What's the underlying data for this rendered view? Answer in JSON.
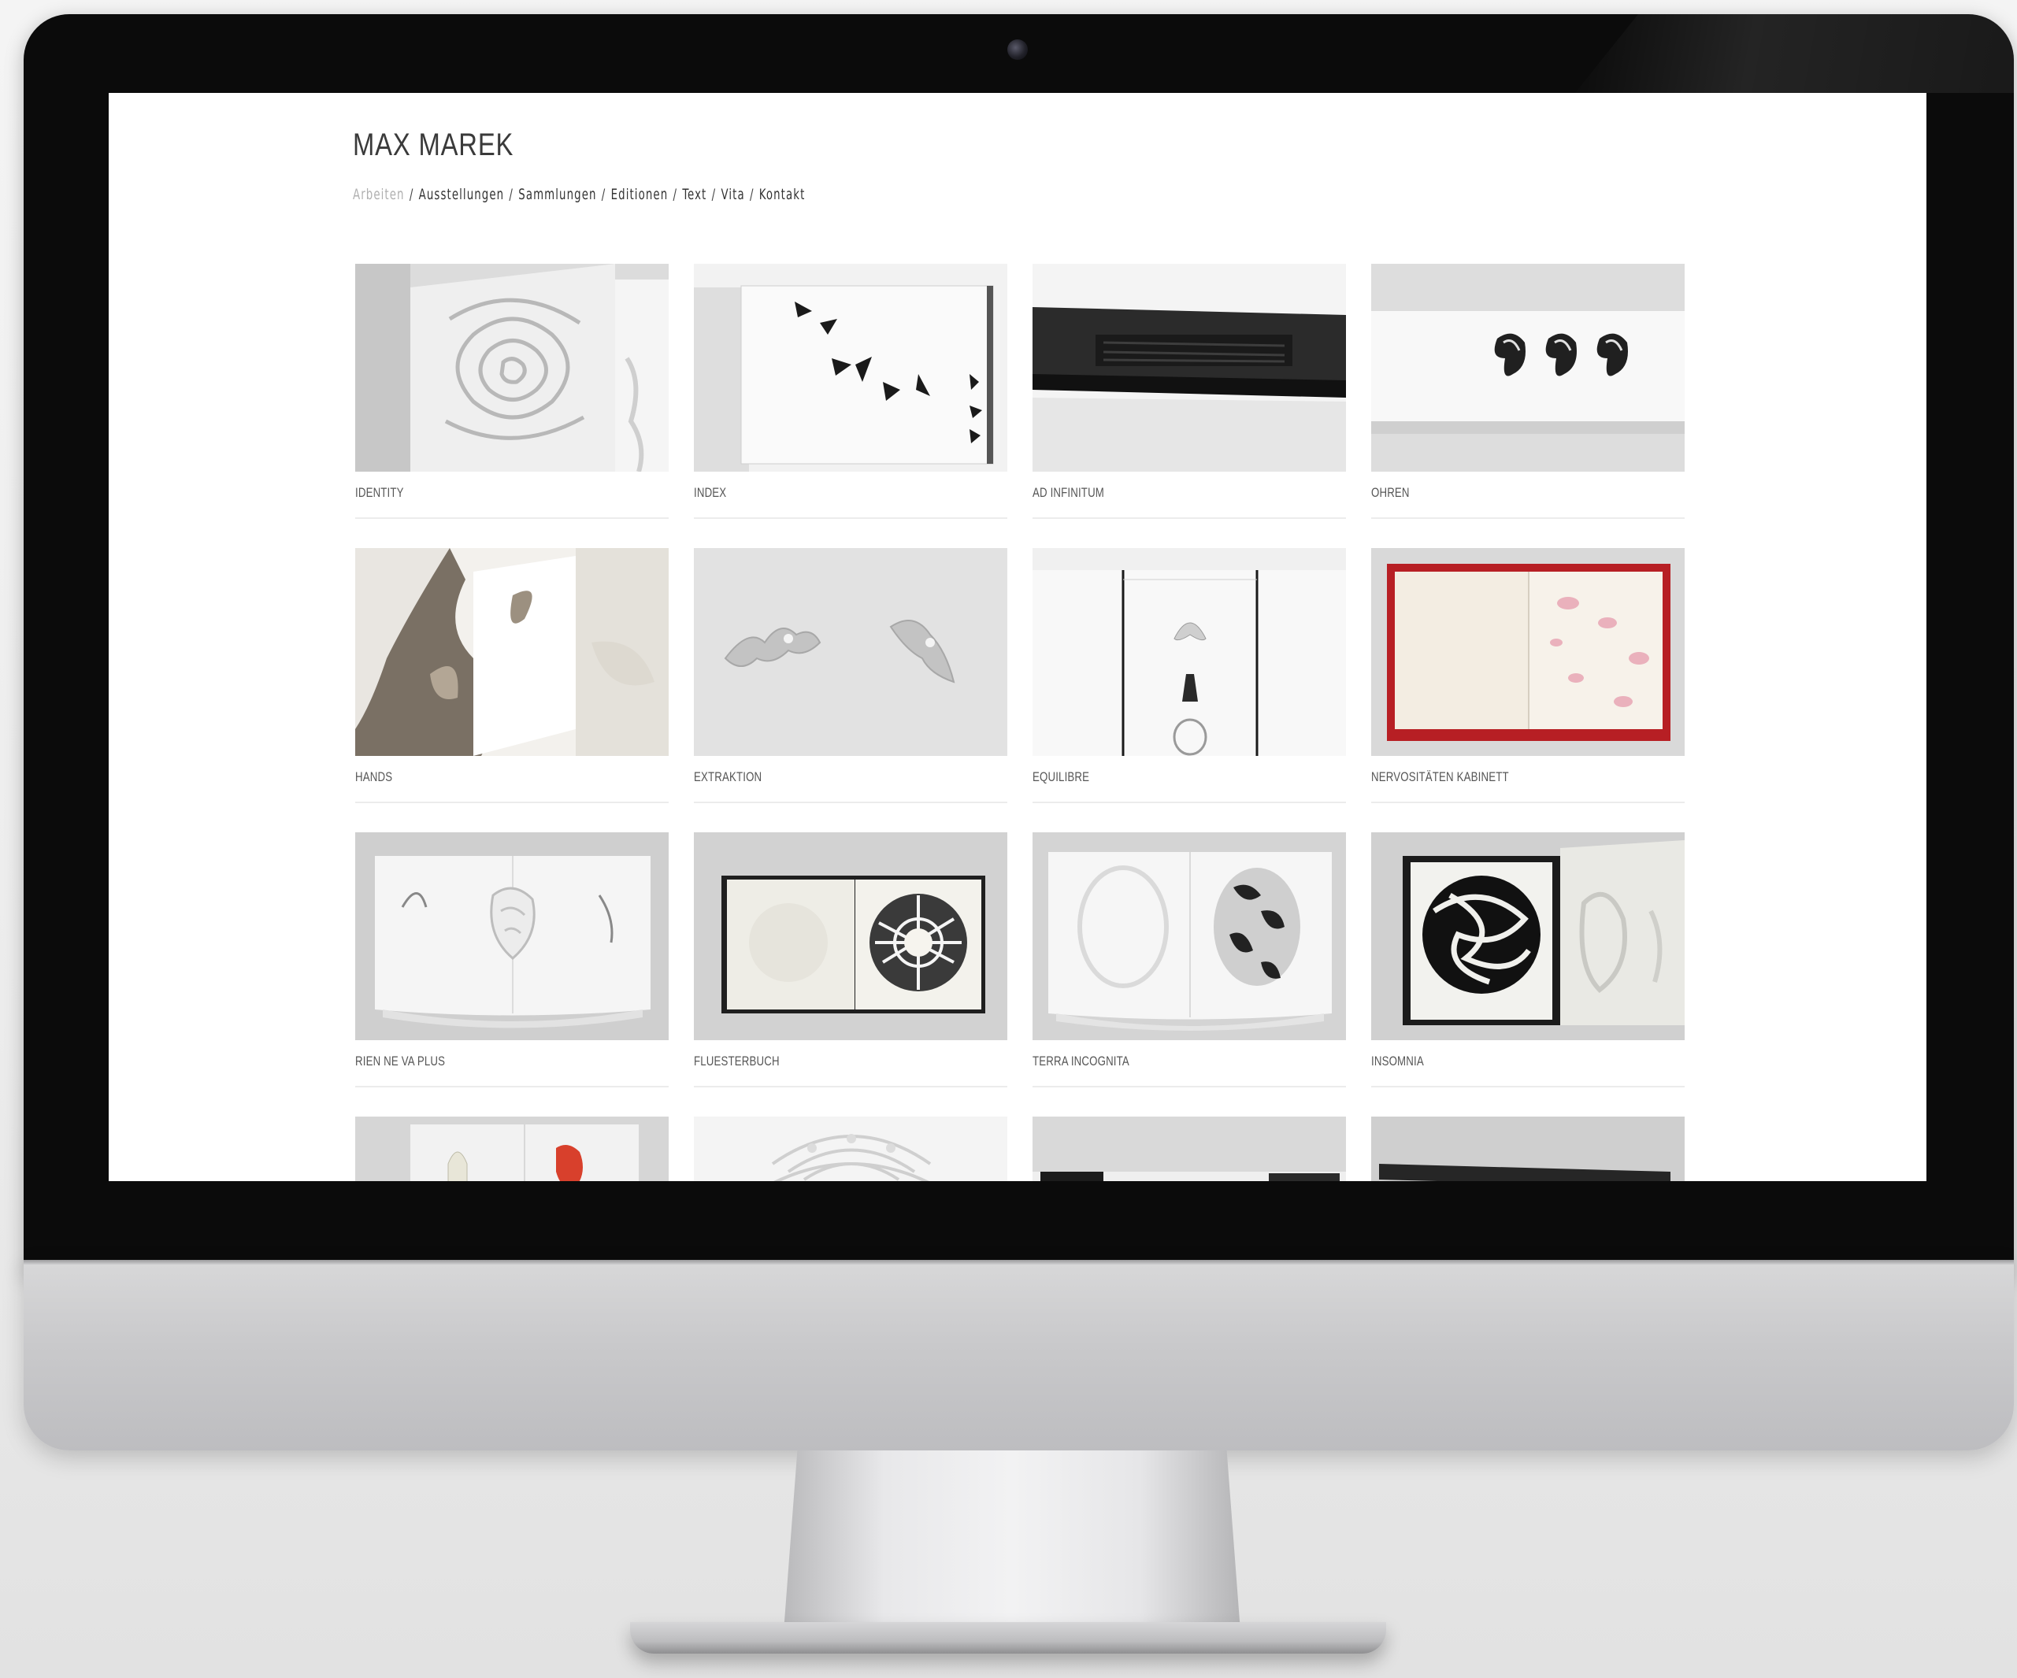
{
  "site": {
    "title": "MAX MAREK",
    "nav": [
      {
        "label": "Arbeiten",
        "active": true
      },
      {
        "label": "Ausstellungen",
        "active": false
      },
      {
        "label": "Sammlungen",
        "active": false
      },
      {
        "label": "Editionen",
        "active": false
      },
      {
        "label": "Text",
        "active": false
      },
      {
        "label": "Vita",
        "active": false
      },
      {
        "label": "Kontakt",
        "active": false
      }
    ],
    "nav_separator": "/"
  },
  "works": [
    {
      "title": "IDENTITY"
    },
    {
      "title": "INDEX"
    },
    {
      "title": "AD INFINITUM"
    },
    {
      "title": "OHREN"
    },
    {
      "title": "HANDS"
    },
    {
      "title": "EXTRAKTION"
    },
    {
      "title": "EQUILIBRE"
    },
    {
      "title": "NERVOSITÄTEN KABINETT"
    },
    {
      "title": "RIEN NE VA PLUS"
    },
    {
      "title": "FLUESTERBUCH"
    },
    {
      "title": "TERRA INCOGNITA"
    },
    {
      "title": "INSOMNIA"
    },
    {
      "title": ""
    },
    {
      "title": ""
    },
    {
      "title": ""
    },
    {
      "title": ""
    }
  ],
  "colors": {
    "nav_active": "#b0b0b0",
    "text": "#333333",
    "bezel": "#0b0b0b",
    "chin": "#c9c9cb"
  }
}
